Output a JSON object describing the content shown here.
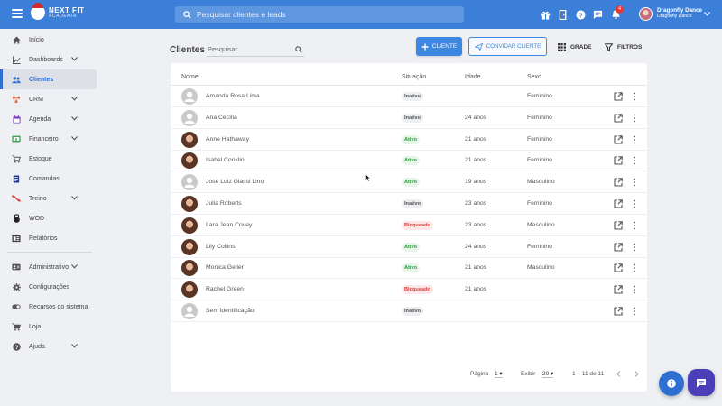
{
  "topbar": {
    "logo_line1": "NEXT FIT",
    "logo_line2": "ACADEMIA",
    "search_placeholder": "Pesquisar clientes e leads",
    "notification_count": "4",
    "user_name": "Dragonfly Dance",
    "user_subtitle": "Dragonfly Dance",
    "icons": [
      "gift-icon",
      "door-exit-icon",
      "help-icon",
      "chat-icon",
      "bell-icon"
    ]
  },
  "sidebar": {
    "items": [
      {
        "label": "Início",
        "icon": "home-icon"
      },
      {
        "label": "Dashboards",
        "icon": "chart-line-icon"
      },
      {
        "label": "Clientes",
        "icon": "people-icon"
      },
      {
        "label": "CRM",
        "icon": "crm-icon"
      },
      {
        "label": "Agenda",
        "icon": "calendar-icon"
      },
      {
        "label": "Financeiro",
        "icon": "money-icon"
      },
      {
        "label": "Estoque",
        "icon": "cart-icon"
      },
      {
        "label": "Comandas",
        "icon": "receipt-icon"
      },
      {
        "label": "Treino",
        "icon": "dumbbell-icon"
      },
      {
        "label": "WOD",
        "icon": "kettlebell-icon"
      },
      {
        "label": "Relatórios",
        "icon": "report-icon"
      },
      {
        "label": "Administrativo",
        "icon": "id-card-icon"
      },
      {
        "label": "Configurações",
        "icon": "gear-icon"
      },
      {
        "label": "Recursos do sistema",
        "icon": "toggle-icon"
      },
      {
        "label": "Loja",
        "icon": "shop-cart-icon"
      },
      {
        "label": "Ajuda",
        "icon": "help-icon"
      }
    ]
  },
  "page": {
    "title": "Clientes",
    "search_placeholder": "Pesquisar",
    "btn_cliente": "CLIENTE",
    "btn_convidar": "CONVIDAR CLIENTE",
    "btn_grade": "GRADE",
    "btn_filtros": "FILTROS"
  },
  "table": {
    "headers": {
      "nome": "Nome",
      "situacao": "Situação",
      "idade": "Idade",
      "sexo": "Sexo"
    },
    "rows": [
      {
        "name": "Amanda Rosa Lima",
        "status": "Inativo",
        "age": "",
        "sex": "Feminino",
        "photo": false
      },
      {
        "name": "Ana Cecília",
        "status": "Inativo",
        "age": "24 anos",
        "sex": "Feminino",
        "photo": false
      },
      {
        "name": "Anne Hathaway",
        "status": "Ativo",
        "age": "21 anos",
        "sex": "Feminino",
        "photo": true
      },
      {
        "name": "Isabel Conklin",
        "status": "Ativo",
        "age": "21 anos",
        "sex": "Feminino",
        "photo": true
      },
      {
        "name": "Jose Luiz Giassi Lino",
        "status": "Ativo",
        "age": "19 anos",
        "sex": "Masculino",
        "photo": false
      },
      {
        "name": "Julia Roberts",
        "status": "Inativo",
        "age": "23 anos",
        "sex": "Feminino",
        "photo": true
      },
      {
        "name": "Lara Jean Covey",
        "status": "Bloqueado",
        "age": "23 anos",
        "sex": "Masculino",
        "photo": true
      },
      {
        "name": "Lily Collins",
        "status": "Ativo",
        "age": "24 anos",
        "sex": "Feminino",
        "photo": true
      },
      {
        "name": "Monica Geller",
        "status": "Ativo",
        "age": "21 anos",
        "sex": "Masculino",
        "photo": true
      },
      {
        "name": "Rachel Green",
        "status": "Bloqueado",
        "age": "21 anos",
        "sex": "",
        "photo": true
      },
      {
        "name": "Sem identificação",
        "status": "Inativo",
        "age": "",
        "sex": "",
        "photo": false
      }
    ]
  },
  "pagination": {
    "page_label": "Página",
    "page_value": "1",
    "show_label": "Exibir",
    "show_value": "20",
    "range": "1 – 11 de 11"
  },
  "colors": {
    "brand": "#3c7fd9",
    "active": "#2e9a43",
    "blocked": "#d83b3b",
    "fab_chat": "#4a3fb8"
  }
}
